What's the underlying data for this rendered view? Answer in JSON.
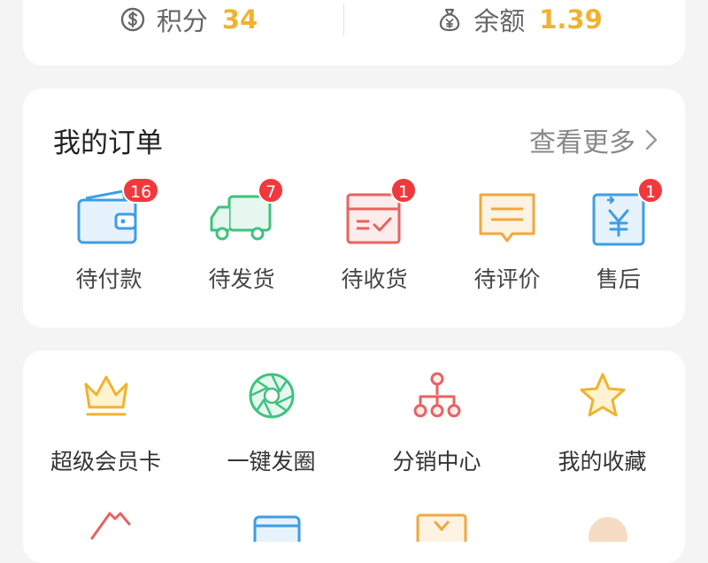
{
  "stats": {
    "points_label": "积分",
    "points_value": "34",
    "balance_label": "余额",
    "balance_value": "1.39"
  },
  "orders": {
    "title": "我的订单",
    "more_label": "查看更多",
    "items": [
      {
        "label": "待付款",
        "badge": "16",
        "icon": "wallet-icon"
      },
      {
        "label": "待发货",
        "badge": "7",
        "icon": "truck-icon"
      },
      {
        "label": "待收货",
        "badge": "1",
        "icon": "package-icon"
      },
      {
        "label": "待评价",
        "badge": "",
        "icon": "comment-icon"
      },
      {
        "label": "售后",
        "badge": "1",
        "icon": "refund-icon"
      }
    ]
  },
  "services": {
    "items": [
      {
        "label": "超级会员卡",
        "icon": "crown-icon"
      },
      {
        "label": "一键发圈",
        "icon": "aperture-icon"
      },
      {
        "label": "分销中心",
        "icon": "network-icon"
      },
      {
        "label": "我的收藏",
        "icon": "star-icon"
      }
    ]
  },
  "colors": {
    "accent": "#f0b32f",
    "badge": "#f0393d",
    "blue": "#3e9ee5",
    "green": "#3fc27f",
    "red": "#e8625f",
    "orange": "#f2a73d"
  }
}
